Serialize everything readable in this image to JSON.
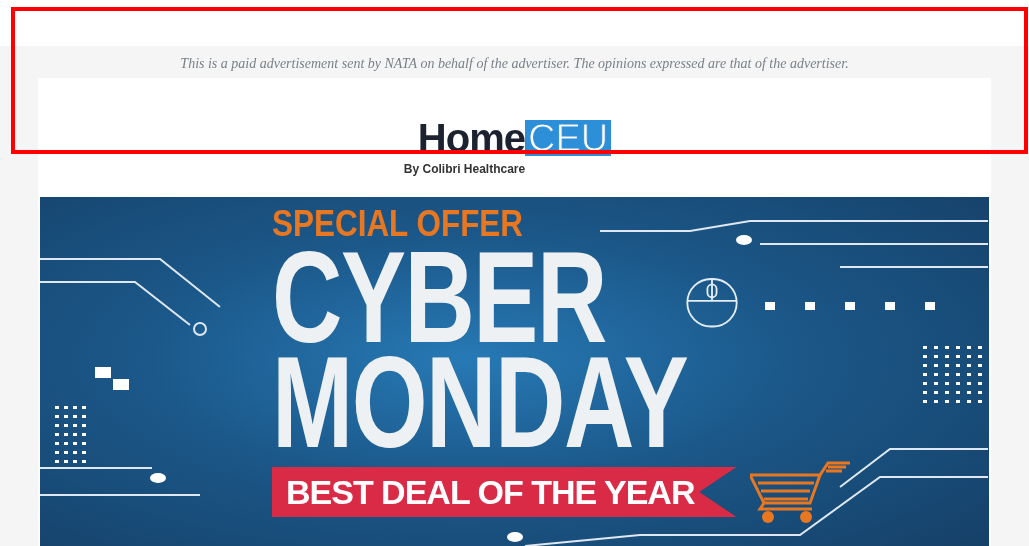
{
  "disclaimer": "This is a paid advertisement sent by NATA on behalf of the advertiser. The opinions expressed are that of the advertiser.",
  "logo": {
    "word": "Home",
    "highlight": "CEU",
    "tagline": "By Colibri Healthcare"
  },
  "banner": {
    "kicker": "SPECIAL OFFER",
    "headline": [
      "CYBER",
      "MONDAY"
    ],
    "ribbon": "BEST DEAL OF THE YEAR"
  },
  "annotation": {
    "color": "#ff0000"
  }
}
